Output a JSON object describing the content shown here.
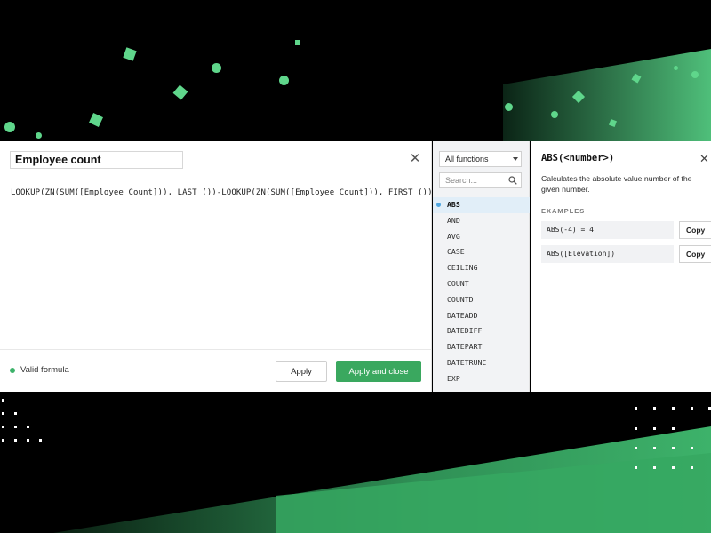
{
  "colors": {
    "accent_green": "#3aa85f",
    "deco_green": "#5fd68b",
    "valid_green": "#3db26a",
    "active_dot_blue": "#4fa6e0",
    "active_row_bg": "#e1eef8",
    "background": "#000000"
  },
  "editor": {
    "calculation_name": "Employee count",
    "close_icon": "close-icon",
    "formula": "LOOKUP(ZN(SUM([Employee Count])), LAST ())-LOOKUP(ZN(SUM([Employee Count])), FIRST ())",
    "status_text": "Valid formula",
    "apply_label": "Apply",
    "apply_close_label": "Apply and close"
  },
  "functions": {
    "filter_selected": "All functions",
    "search_placeholder": "Search...",
    "search_icon": "search-icon",
    "active": "ABS",
    "items": [
      {
        "label": "ABS"
      },
      {
        "label": "AND"
      },
      {
        "label": "AVG"
      },
      {
        "label": "CASE"
      },
      {
        "label": "CEILING"
      },
      {
        "label": "COUNT"
      },
      {
        "label": "COUNTD"
      },
      {
        "label": "DATEADD"
      },
      {
        "label": "DATEDIFF"
      },
      {
        "label": "DATEPART"
      },
      {
        "label": "DATETRUNC"
      },
      {
        "label": "EXP"
      }
    ]
  },
  "detail": {
    "signature": "ABS(<number>)",
    "close_icon": "close-icon",
    "description": "Calculates the absolute value number of the given number.",
    "examples_header": "EXAMPLES",
    "examples": [
      {
        "code": "ABS(-4) = 4",
        "copy_label": "Copy"
      },
      {
        "code": "ABS([Elevation])",
        "copy_label": "Copy"
      }
    ]
  }
}
